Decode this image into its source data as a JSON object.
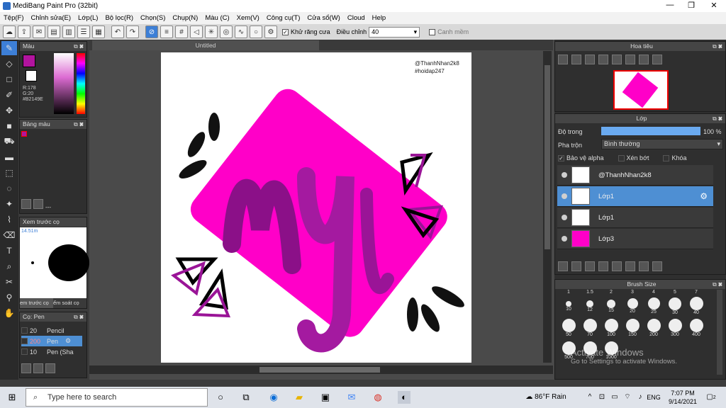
{
  "window": {
    "title": "MediBang Paint Pro (32bit)"
  },
  "menu": [
    "Tệp(F)",
    "Chỉnh sửa(E)",
    "Lớp(L)",
    "Bộ lọc(R)",
    "Chọn(S)",
    "Chụp(N)",
    "Màu (C)",
    "Xem(V)",
    "Công cụ(T)",
    "Cửa sổ(W)",
    "Cloud",
    "Help"
  ],
  "toolbar": {
    "antialias_label": "Khử răng cưa",
    "adjust_label": "Điều chỉnh",
    "adjust_value": "40",
    "smooth_label": "Canh mềm"
  },
  "color_panel": {
    "title": "Màu",
    "r": "R:178",
    "g": "G:20",
    "b": "B:158",
    "hex": "#B2149E",
    "primary": "#B2149E"
  },
  "palette_panel": {
    "title": "Bảng màu",
    "footer": "---"
  },
  "preview_panel": {
    "title": "Xem trước cọ",
    "size": "14.51m",
    "tab1": "em trước cọ",
    "tab2": "ểm soát cọ"
  },
  "brush_panel": {
    "title": "Cọ: Pen",
    "items": [
      {
        "size": "20",
        "name": "Pencil"
      },
      {
        "size": "200",
        "name": "Pen"
      },
      {
        "size": "10",
        "name": "Pen (Sha"
      }
    ]
  },
  "canvas": {
    "tab": "Untitled",
    "credit1": "@ThanhNhan2k8",
    "credit2": "#hoidap247",
    "art_text": "My"
  },
  "navigator": {
    "title": "Hoa tiêu"
  },
  "layer_panel": {
    "title": "Lớp",
    "opacity_label": "Độ trong",
    "opacity_value": "100 %",
    "opacity_fraction": 1.0,
    "blend_label": "Pha trộn",
    "blend_value": "Bình thường",
    "protect_alpha": "Bảo vệ alpha",
    "clipping": "Xén bớt",
    "lock": "Khóa",
    "layers": [
      {
        "name": "@ThanhNhan2k8"
      },
      {
        "name": "Lớp1"
      },
      {
        "name": "Lớp1"
      },
      {
        "name": "Lớp3"
      }
    ]
  },
  "brush_size": {
    "title": "Brush Size",
    "header": [
      "1",
      "1.5",
      "2",
      "3",
      "4",
      "5",
      "7"
    ],
    "row1": [
      "10",
      "12",
      "15",
      "20",
      "25",
      "30",
      "40"
    ],
    "row2": [
      "50",
      "70",
      "100",
      "150",
      "200",
      "300",
      "400"
    ],
    "row3": [
      "500",
      "700",
      "1000"
    ]
  },
  "watermark": {
    "line1": "Activate Windows",
    "line2": "Go to Settings to activate Windows."
  },
  "taskbar": {
    "search_placeholder": "Type here to search",
    "weather": "86°F Rain",
    "lang": "ENG",
    "time": "7:07 PM",
    "date": "9/14/2021",
    "notif_count": "2"
  }
}
